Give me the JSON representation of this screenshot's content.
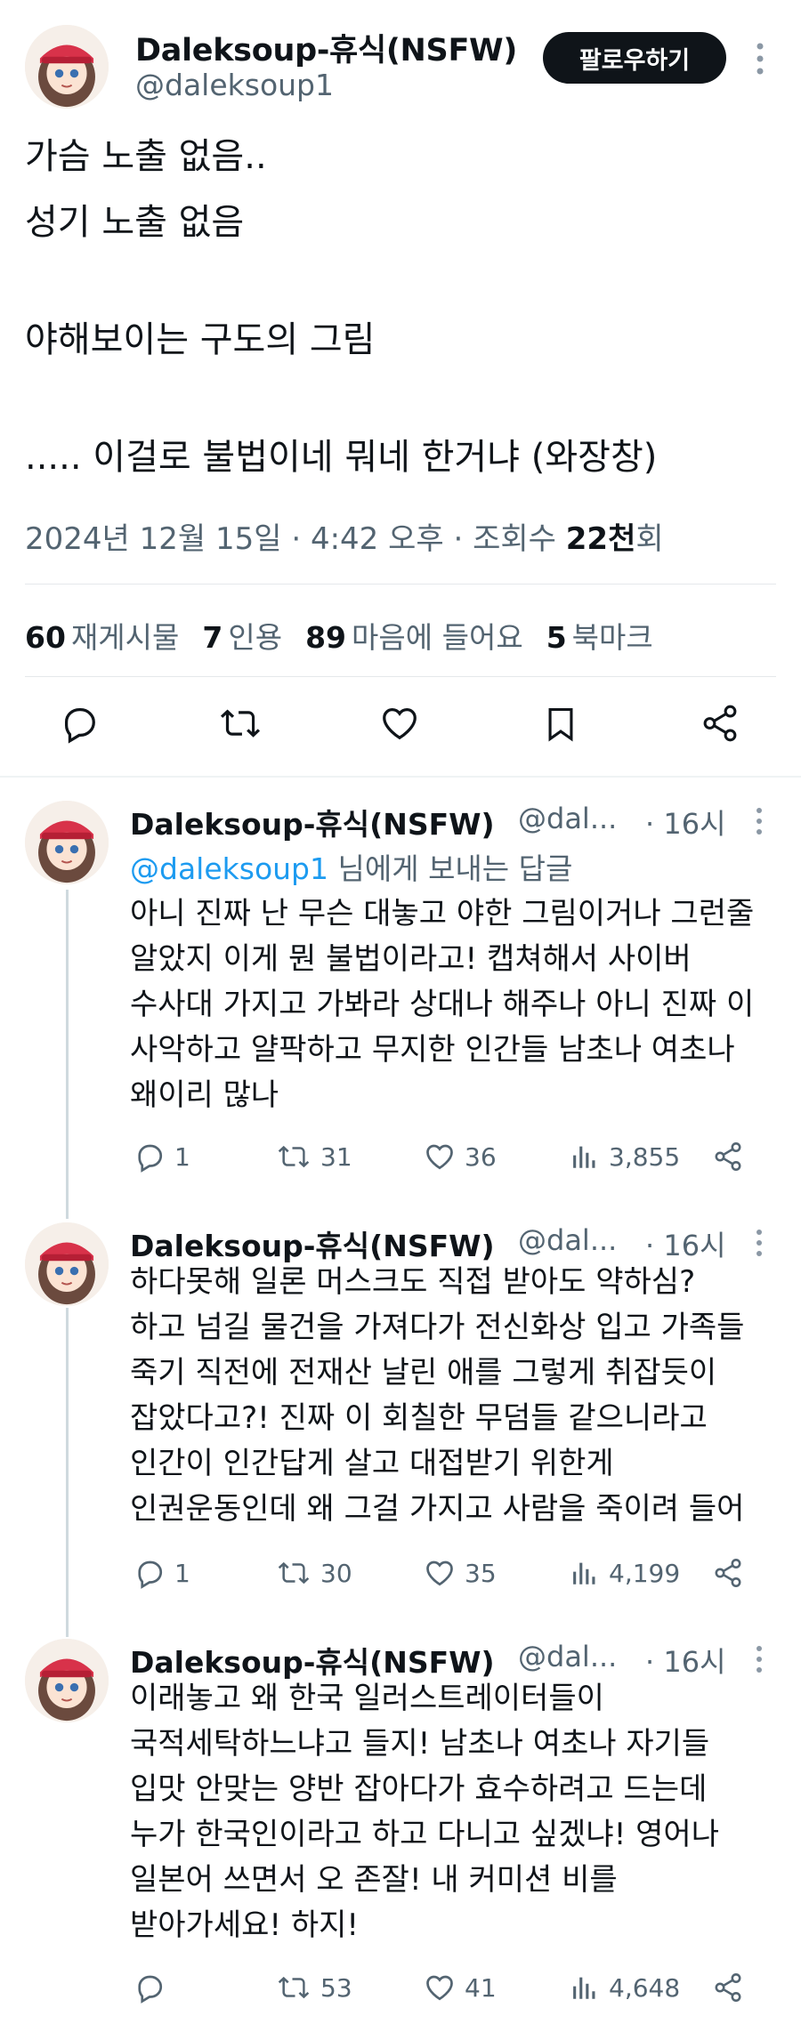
{
  "main_tweet": {
    "author_name": "Daleksoup-휴식(NSFW)",
    "author_handle": "@daleksoup1",
    "follow_label": "팔로우하기",
    "lines": [
      "가슴 노출 없음..",
      "성기 노출 없음",
      "야해보이는 구도의 그림",
      "..... 이걸로 불법이네 뭐네 한거냐 (와장창)"
    ],
    "date": "2024년 12월 15일",
    "time": "4:42 오후",
    "views_label": "조회수",
    "views_value": "22천",
    "views_suffix": "회",
    "stats": [
      {
        "value": "60",
        "label": "재게시물"
      },
      {
        "value": "7",
        "label": "인용"
      },
      {
        "value": "89",
        "label": "마음에 들어요"
      },
      {
        "value": "5",
        "label": "북마크"
      }
    ],
    "action_icons": [
      "reply-icon",
      "retweet-icon",
      "like-icon",
      "bookmark-icon",
      "share-icon"
    ]
  },
  "replies": [
    {
      "author_name": "Daleksoup-휴식(NSFW)",
      "author_handle": "@dal...",
      "time": "· 16시",
      "replying_to": "@daleksoup1",
      "replying_suffix": "님에게 보내는 답글",
      "lines": [
        "아니 진짜 난 무슨 대놓고 야한 그림이거나 그런줄",
        "알았지 이게 뭔 불법이라고! 캡쳐해서 사이버",
        "수사대 가지고 가봐라 상대나 해주나 아니 진짜 이",
        "사악하고 얄팍하고 무지한 인간들 남초나 여초나",
        "왜이리 많나"
      ],
      "replies_count": "1",
      "retweets_count": "31",
      "likes_count": "36",
      "views_count": "3,855"
    },
    {
      "author_name": "Daleksoup-휴식(NSFW)",
      "author_handle": "@dal...",
      "time": "· 16시",
      "lines": [
        "하다못해 일론 머스크도 직접 받아도 약하심?",
        "하고 넘길 물건을 가져다가 전신화상 입고 가족들",
        "죽기 직전에 전재산 날린 애를 그렇게 취잡듯이",
        "잡았다고?! 진짜 이 회칠한 무덤들 같으니라고",
        "인간이 인간답게 살고 대접받기 위한게",
        "인권운동인데 왜 그걸 가지고 사람을 죽이려 들어"
      ],
      "replies_count": "1",
      "retweets_count": "30",
      "likes_count": "35",
      "views_count": "4,199"
    },
    {
      "author_name": "Daleksoup-휴식(NSFW)",
      "author_handle": "@dal...",
      "time": "· 16시",
      "lines": [
        "이래놓고 왜 한국 일러스트레이터들이",
        "국적세탁하느냐고 들지! 남초나 여초나 자기들",
        "입맛 안맞는 양반 잡아다가 효수하려고 드는데",
        "누가 한국인이라고 하고 다니고 싶겠냐! 영어나",
        "일본어 쓰면서 오 존잘! 내 커미션 비를",
        "받아가세요! 하지!"
      ],
      "replies_count": "",
      "retweets_count": "53",
      "likes_count": "41",
      "views_count": "4,648"
    }
  ],
  "colors": {
    "text": "#0f1419",
    "secondary": "#536471",
    "link": "#1d9bf0",
    "divider": "#eff3f4",
    "button_bg": "#0f1419"
  }
}
